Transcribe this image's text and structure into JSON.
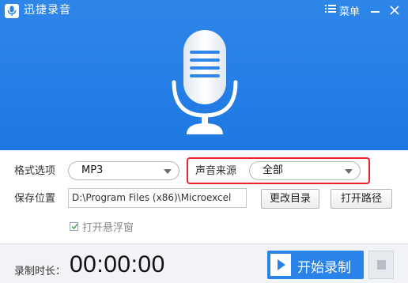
{
  "app": {
    "title": "迅捷录音",
    "menu_label": "菜单"
  },
  "settings": {
    "format_label": "格式选项",
    "format_value": "MP3",
    "source_label": "声音来源",
    "source_value": "全部",
    "save_label": "保存位置",
    "save_path": "D:\\Program Files (x86)\\Microexcel",
    "change_dir_button": "更改目录",
    "open_path_button": "打开路径",
    "float_window_label": "打开悬浮窗",
    "float_window_checked": true
  },
  "footer": {
    "duration_label": "录制时长：",
    "duration_value": "00:00:00",
    "start_button": "开始录制"
  },
  "icons": {
    "app_logo": "microphone-icon",
    "menu": "list-icon",
    "minimize": "minimize-icon",
    "close": "close-icon",
    "hero": "microphone-icon",
    "play": "play-icon",
    "stop": "stop-icon"
  },
  "colors": {
    "accent": "#2a83e8",
    "highlight": "#e8232d"
  }
}
